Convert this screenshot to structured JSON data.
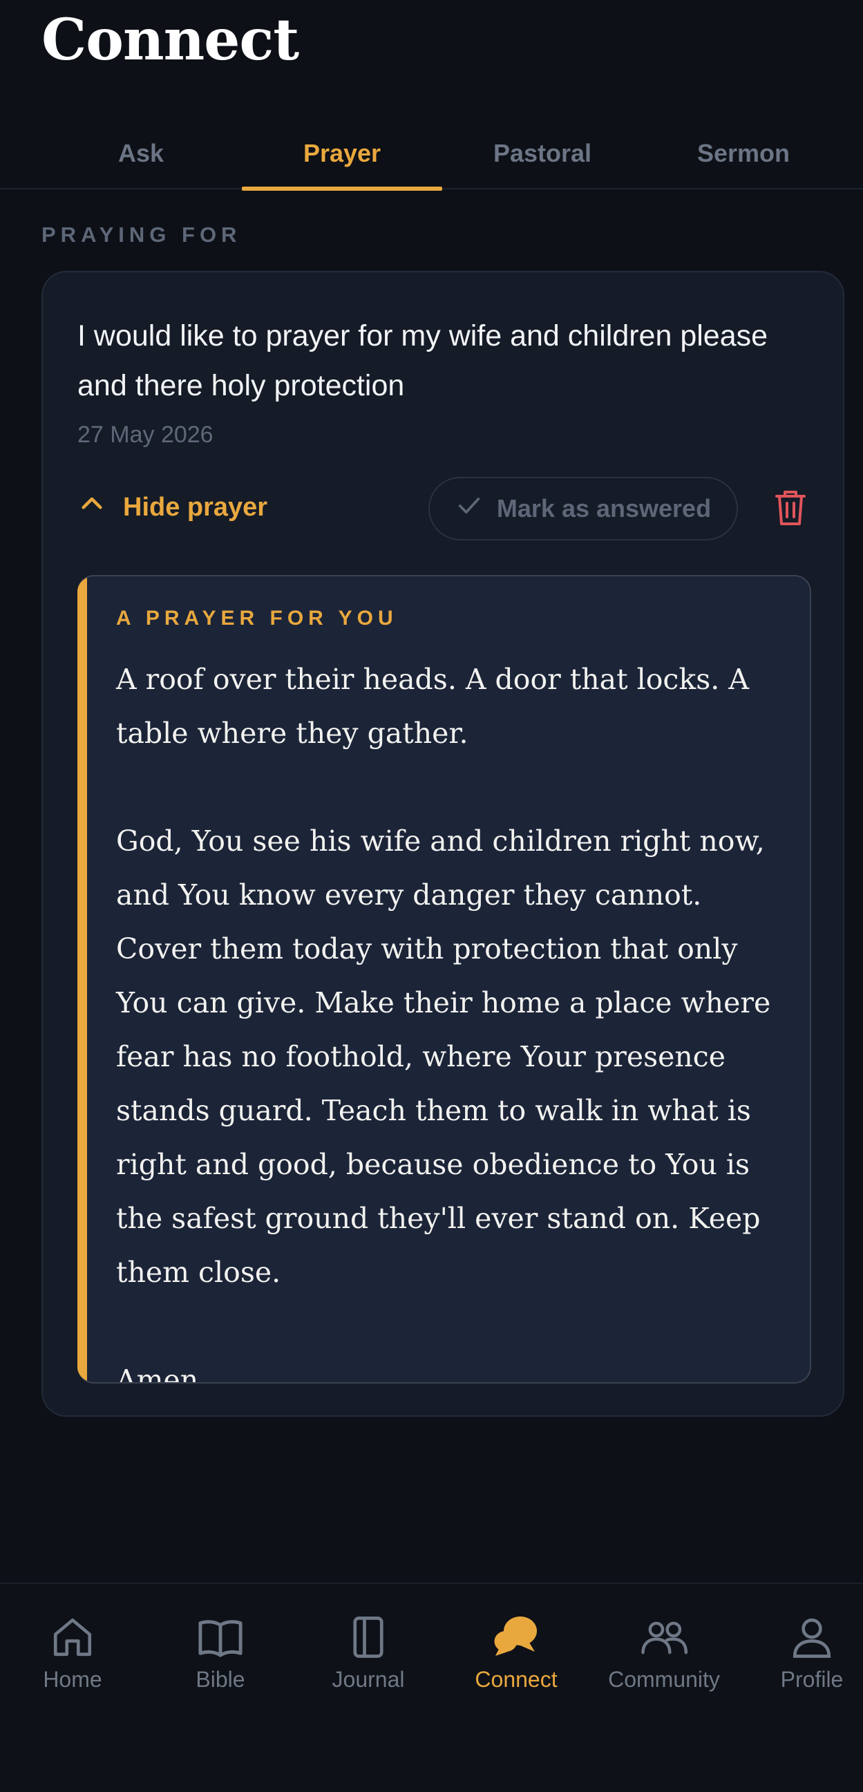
{
  "header": {
    "title": "Connect"
  },
  "tabs": [
    {
      "label": "Ask",
      "active": false
    },
    {
      "label": "Prayer",
      "active": true
    },
    {
      "label": "Pastoral",
      "active": false
    },
    {
      "label": "Sermon",
      "active": false
    }
  ],
  "section": {
    "label": "PRAYING FOR"
  },
  "request": {
    "text": "I would like to prayer for my wife and children please and there holy protection",
    "date": "27 May 2026",
    "hide_label": "Hide prayer",
    "answer_label": "Mark as answered"
  },
  "prayer": {
    "label": "A PRAYER FOR YOU",
    "paragraphs": [
      "A roof over their heads. A door that locks. A table where they gather.",
      "God, You see his wife and children right now, and You know every danger they cannot. Cover them today with protection that only You can give. Make their home a place where fear has no foothold, where Your presence stands guard. Teach them to walk in what is right and good, because obedience to You is the safest ground they'll ever stand on. Keep them close.",
      "Amen."
    ]
  },
  "nav": [
    {
      "label": "Home",
      "icon": "home-icon",
      "active": false
    },
    {
      "label": "Bible",
      "icon": "book-icon",
      "active": false
    },
    {
      "label": "Journal",
      "icon": "journal-icon",
      "active": false
    },
    {
      "label": "Connect",
      "icon": "chat-icon",
      "active": true
    },
    {
      "label": "Community",
      "icon": "people-icon",
      "active": false
    },
    {
      "label": "Profile",
      "icon": "person-icon",
      "active": false
    }
  ],
  "colors": {
    "background": "#0d1016",
    "card": "#151b27",
    "prayer_box": "#1c2438",
    "accent": "#e9a83e",
    "muted": "#6f7886",
    "danger": "#e0555a"
  }
}
